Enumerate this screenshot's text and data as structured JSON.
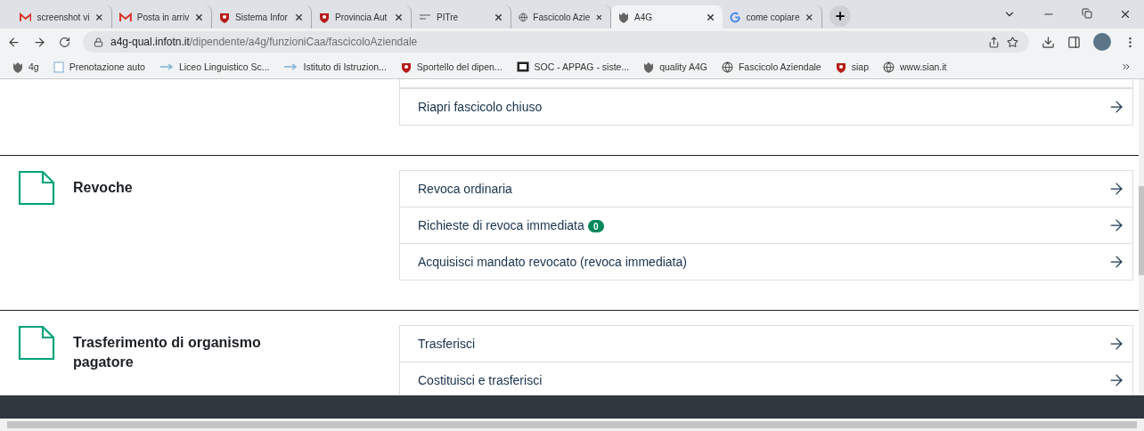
{
  "tabs": [
    {
      "title": "screenshot vi",
      "selected": false
    },
    {
      "title": "Posta in arriv",
      "selected": false
    },
    {
      "title": "Sistema Infor",
      "selected": false
    },
    {
      "title": "Provincia Aut",
      "selected": false
    },
    {
      "title": "PITre",
      "selected": false
    },
    {
      "title": "Fascicolo Azie",
      "selected": false
    },
    {
      "title": "A4G",
      "selected": true
    },
    {
      "title": "come copiare",
      "selected": false
    }
  ],
  "address": {
    "host": "a4g-qual.infotn.it",
    "path": "/dipendente/a4g/funzioniCaa/fascicoloAziendale"
  },
  "bookmarks": [
    "4g",
    "Prenotazione auto",
    "Liceo Linguistico Sc...",
    "Istituto di Istruzion...",
    "Sportello del dipen...",
    "SOC - APPAG - siste...",
    "quality A4G",
    "Fascicolo Aziendale",
    "siap",
    "www.sian.it"
  ],
  "sections": [
    {
      "items": [
        {
          "label": "Riapri fascicolo chiuso"
        }
      ]
    },
    {
      "title": "Revoche",
      "items": [
        {
          "label": "Revoca ordinaria"
        },
        {
          "label": "Richieste di revoca immediata",
          "badge": "0"
        },
        {
          "label": "Acquisisci mandato revocato (revoca immediata)"
        }
      ]
    },
    {
      "title": "Trasferimento di organismo pagatore",
      "items": [
        {
          "label": "Trasferisci"
        },
        {
          "label": "Costituisci e trasferisci"
        }
      ]
    }
  ]
}
